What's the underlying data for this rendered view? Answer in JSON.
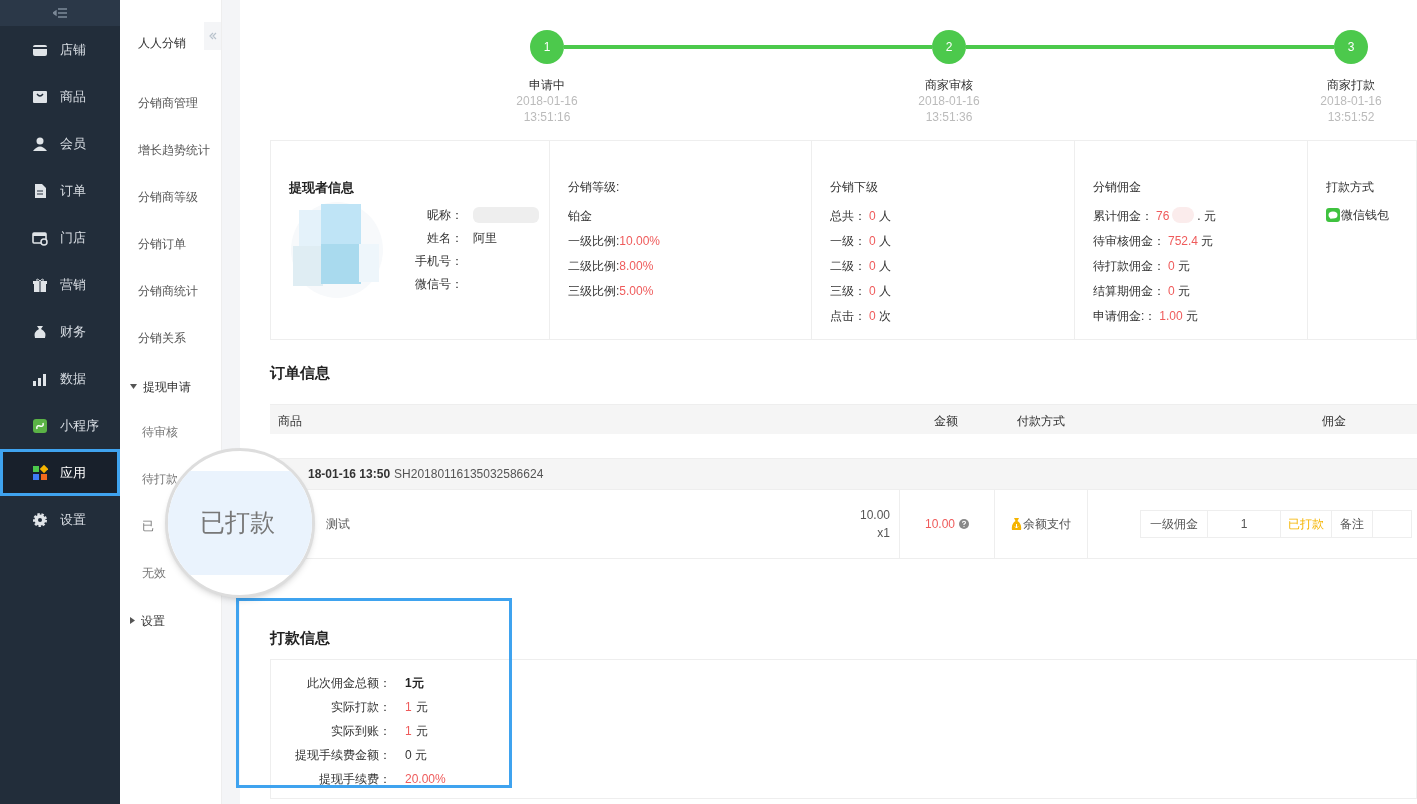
{
  "sidebar": {
    "items": [
      {
        "label": "店铺",
        "selected": false,
        "highlighted": false
      },
      {
        "label": "商品",
        "selected": false,
        "highlighted": false
      },
      {
        "label": "会员",
        "selected": false,
        "highlighted": false
      },
      {
        "label": "订单",
        "selected": false,
        "highlighted": false
      },
      {
        "label": "门店",
        "selected": false,
        "highlighted": false
      },
      {
        "label": "营销",
        "selected": false,
        "highlighted": false
      },
      {
        "label": "财务",
        "selected": false,
        "highlighted": false
      },
      {
        "label": "数据",
        "selected": false,
        "highlighted": false
      },
      {
        "label": "小程序",
        "selected": false,
        "highlighted": false
      },
      {
        "label": "应用",
        "selected": true,
        "highlighted": true
      },
      {
        "label": "设置",
        "selected": false,
        "highlighted": false
      }
    ]
  },
  "subnav": {
    "title": "人人分销",
    "items": [
      {
        "label": "分销商管理",
        "kind": "link"
      },
      {
        "label": "增长趋势统计",
        "kind": "link"
      },
      {
        "label": "分销商等级",
        "kind": "link"
      },
      {
        "label": "分销订单",
        "kind": "link"
      },
      {
        "label": "分销商统计",
        "kind": "link"
      },
      {
        "label": "分销关系",
        "kind": "link"
      },
      {
        "label": "提现申请",
        "kind": "group",
        "expanded": true,
        "children": [
          {
            "label": "待审核"
          },
          {
            "label": "待打款"
          },
          {
            "label": "已"
          },
          {
            "label": "无效"
          }
        ]
      },
      {
        "label": "设置",
        "kind": "group",
        "expanded": false
      }
    ]
  },
  "magnifier": {
    "text": "已打款"
  },
  "steps": [
    {
      "number": "1",
      "label": "申请中",
      "date": "2018-01-16",
      "time": "13:51:16",
      "done": true
    },
    {
      "number": "2",
      "label": "商家审核",
      "date": "2018-01-16",
      "time": "13:51:36",
      "done": true
    },
    {
      "number": "3",
      "label": "商家打款",
      "date": "2018-01-16",
      "time": "13:51:52",
      "done": true
    }
  ],
  "withdrawer": {
    "title": "提现者信息",
    "fields": [
      {
        "label": "昵称：",
        "redacted": true
      },
      {
        "label": "姓名：",
        "value": "阿里"
      },
      {
        "label": "手机号："
      },
      {
        "label": "微信号："
      }
    ]
  },
  "grade_card": {
    "title": "分销等级:",
    "grade": "铂金",
    "rates": [
      {
        "label": "一级比例:",
        "value": "10.00%"
      },
      {
        "label": "二级比例:",
        "value": "8.00%"
      },
      {
        "label": "三级比例:",
        "value": "5.00%"
      }
    ]
  },
  "downline": {
    "title": "分销下级",
    "rows": [
      {
        "label": "总共：",
        "value": "0",
        "unit": "人"
      },
      {
        "label": "一级：",
        "value": "0",
        "unit": "人"
      },
      {
        "label": "二级：",
        "value": "0",
        "unit": "人"
      },
      {
        "label": "三级：",
        "value": "0",
        "unit": "人"
      },
      {
        "label": "点击：",
        "value": "0",
        "unit": "次"
      }
    ]
  },
  "commission": {
    "title": "分销佣金",
    "rows": [
      {
        "label": "累计佣金：",
        "value": "76",
        "unit": ". 元",
        "redacted": true
      },
      {
        "label": "待审核佣金：",
        "value": "752.4",
        "unit": "元"
      },
      {
        "label": "待打款佣金：",
        "value": "0",
        "unit": "元"
      },
      {
        "label": "结算期佣金：",
        "value": "0",
        "unit": "元"
      },
      {
        "label": "申请佣金:：",
        "value": "1.00",
        "unit": "元"
      }
    ]
  },
  "payout_method": {
    "title": "打款方式",
    "method": "微信钱包"
  },
  "order_info": {
    "title": "订单信息",
    "columns": [
      "商品",
      "金额",
      "付款方式",
      "佣金"
    ],
    "orders": [
      {
        "date": "18-01-16 13:50",
        "order_no": "SH20180116135032586624",
        "items": [
          {
            "name": "测试",
            "price": "10.00",
            "qty": "x1",
            "amount": "10.00",
            "payment": "余额支付",
            "commission": {
              "level_label": "一级佣金",
              "value": "1",
              "status": "已打款",
              "note": "备注"
            }
          }
        ]
      }
    ]
  },
  "payment_info": {
    "title": "打款信息",
    "highlighted": true,
    "rows": [
      {
        "label": "此次佣金总额：",
        "value": "1元",
        "kind": "total"
      },
      {
        "label": "实际打款：",
        "value": "1",
        "unit": "元",
        "kind": "amount"
      },
      {
        "label": "实际到账：",
        "value": "1",
        "unit": "元",
        "kind": "amount"
      },
      {
        "label": "提现手续费金额：",
        "value": "0 元",
        "kind": "plain"
      },
      {
        "label": "提现手续费：",
        "value": "20.00%",
        "kind": "amount"
      }
    ]
  }
}
